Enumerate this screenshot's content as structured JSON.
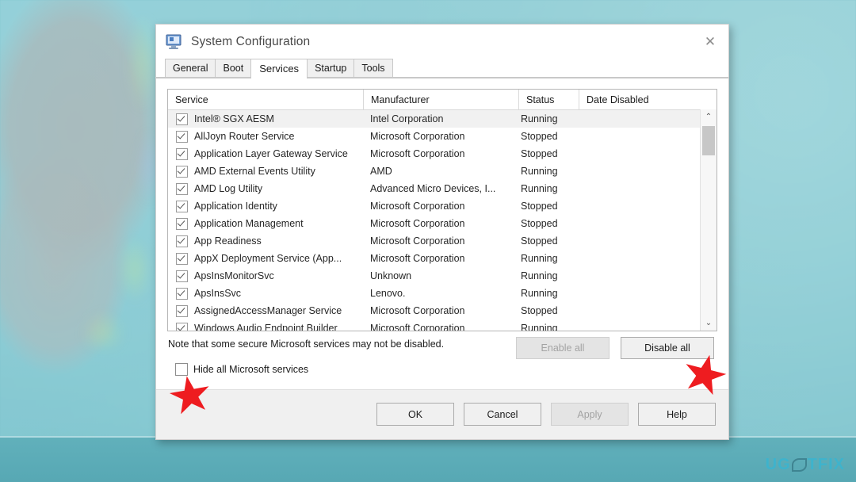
{
  "window": {
    "title": "System Configuration",
    "icon": "computer-monitor-icon",
    "close_label": "✕"
  },
  "tabs": [
    {
      "label": "General",
      "active": false
    },
    {
      "label": "Boot",
      "active": false
    },
    {
      "label": "Services",
      "active": true
    },
    {
      "label": "Startup",
      "active": false
    },
    {
      "label": "Tools",
      "active": false
    }
  ],
  "table": {
    "columns": [
      "Service",
      "Manufacturer",
      "Status",
      "Date Disabled"
    ],
    "rows": [
      {
        "checked": true,
        "service": "Intel® SGX AESM",
        "manufacturer": "Intel Corporation",
        "status": "Running",
        "date_disabled": "",
        "highlighted": true
      },
      {
        "checked": true,
        "service": "AllJoyn Router Service",
        "manufacturer": "Microsoft Corporation",
        "status": "Stopped",
        "date_disabled": "",
        "highlighted": false
      },
      {
        "checked": true,
        "service": "Application Layer Gateway Service",
        "manufacturer": "Microsoft Corporation",
        "status": "Stopped",
        "date_disabled": "",
        "highlighted": false
      },
      {
        "checked": true,
        "service": "AMD External Events Utility",
        "manufacturer": "AMD",
        "status": "Running",
        "date_disabled": "",
        "highlighted": false
      },
      {
        "checked": true,
        "service": "AMD Log Utility",
        "manufacturer": "Advanced Micro Devices, I...",
        "status": "Running",
        "date_disabled": "",
        "highlighted": false
      },
      {
        "checked": true,
        "service": "Application Identity",
        "manufacturer": "Microsoft Corporation",
        "status": "Stopped",
        "date_disabled": "",
        "highlighted": false
      },
      {
        "checked": true,
        "service": "Application Management",
        "manufacturer": "Microsoft Corporation",
        "status": "Stopped",
        "date_disabled": "",
        "highlighted": false
      },
      {
        "checked": true,
        "service": "App Readiness",
        "manufacturer": "Microsoft Corporation",
        "status": "Stopped",
        "date_disabled": "",
        "highlighted": false
      },
      {
        "checked": true,
        "service": "AppX Deployment Service (App...",
        "manufacturer": "Microsoft Corporation",
        "status": "Running",
        "date_disabled": "",
        "highlighted": false
      },
      {
        "checked": true,
        "service": "ApsInsMonitorSvc",
        "manufacturer": "Unknown",
        "status": "Running",
        "date_disabled": "",
        "highlighted": false
      },
      {
        "checked": true,
        "service": "ApsInsSvc",
        "manufacturer": "Lenovo.",
        "status": "Running",
        "date_disabled": "",
        "highlighted": false
      },
      {
        "checked": true,
        "service": "AssignedAccessManager Service",
        "manufacturer": "Microsoft Corporation",
        "status": "Stopped",
        "date_disabled": "",
        "highlighted": false
      },
      {
        "checked": true,
        "service": "Windows Audio Endpoint Builder",
        "manufacturer": "Microsoft Corporation",
        "status": "Running",
        "date_disabled": "",
        "highlighted": false
      }
    ]
  },
  "scrollbar": {
    "up_arrow": "⌃",
    "down_arrow": "⌄"
  },
  "note": {
    "text": "Note that some secure Microsoft services may not be disabled."
  },
  "hide_checkbox": {
    "label": "Hide all Microsoft services",
    "checked": false
  },
  "actions": {
    "enable_all": "Enable all",
    "enable_all_disabled": true,
    "disable_all": "Disable all",
    "disable_all_disabled": false
  },
  "footer_buttons": [
    {
      "label": "OK",
      "disabled": false
    },
    {
      "label": "Cancel",
      "disabled": false
    },
    {
      "label": "Apply",
      "disabled": true
    },
    {
      "label": "Help",
      "disabled": false
    }
  ],
  "annotations": {
    "star_near_hide_checkbox": "red-star-marker",
    "star_near_disable_all": "red-star-marker"
  },
  "watermark": {
    "text_left": "UG",
    "text_right": "TFIX",
    "color": "#35b6d4"
  },
  "colors": {
    "desktop": "#7fc0c8",
    "dialog_bg": "#f0f0f0",
    "panel_bg": "#ffffff",
    "accent_red": "#ee1c20"
  }
}
